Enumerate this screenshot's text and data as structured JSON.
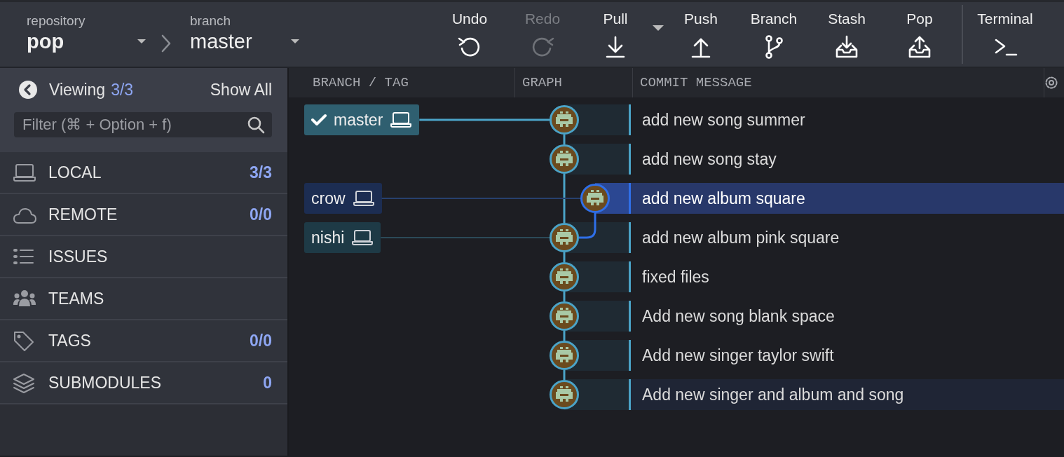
{
  "repository": {
    "label": "repository",
    "name": "pop"
  },
  "branch": {
    "label": "branch",
    "name": "master"
  },
  "toolbar": [
    {
      "kind": "undo",
      "label": "Undo",
      "disabled": false
    },
    {
      "kind": "redo",
      "label": "Redo",
      "disabled": true
    },
    {
      "kind": "pull",
      "label": "Pull",
      "disabled": false
    },
    {
      "kind": "dropdown"
    },
    {
      "kind": "push",
      "label": "Push",
      "disabled": false
    },
    {
      "kind": "branch",
      "label": "Branch",
      "disabled": false
    },
    {
      "kind": "stash",
      "label": "Stash",
      "disabled": false
    },
    {
      "kind": "pop",
      "label": "Pop",
      "disabled": false
    },
    {
      "kind": "divider"
    },
    {
      "kind": "terminal",
      "label": "Terminal",
      "disabled": false
    }
  ],
  "sidebar": {
    "viewing_label": "Viewing",
    "viewing_count": "3/3",
    "show_all": "Show All",
    "filter_placeholder": "Filter (⌘ + Option + f)",
    "items": [
      {
        "kind": "local",
        "label": "LOCAL",
        "count": "3/3"
      },
      {
        "kind": "remote",
        "label": "REMOTE",
        "count": "0/0"
      },
      {
        "kind": "issues",
        "label": "ISSUES"
      },
      {
        "kind": "teams",
        "label": "TEAMS"
      },
      {
        "kind": "tags",
        "label": "TAGS",
        "count": "0/0"
      },
      {
        "kind": "submodules",
        "label": "SUBMODULES",
        "count": "0"
      }
    ]
  },
  "graph": {
    "columns": [
      "BRANCH / TAG",
      "GRAPH",
      "COMMIT MESSAGE"
    ],
    "commits": [
      {
        "message": "add new song summer",
        "side_lane": false,
        "selected": false,
        "highlighted": false,
        "ref": {
          "name": "master",
          "current": true
        }
      },
      {
        "message": "add new song stay",
        "side_lane": false,
        "selected": false,
        "highlighted": false
      },
      {
        "message": "add new album square",
        "side_lane": true,
        "selected": true,
        "highlighted": false,
        "ref": {
          "name": "crow",
          "current": false
        }
      },
      {
        "message": "add new album pink square",
        "side_lane": false,
        "selected": false,
        "highlighted": false,
        "ref": {
          "name": "nishi",
          "current": false
        }
      },
      {
        "message": "fixed files",
        "side_lane": false,
        "selected": false,
        "highlighted": false
      },
      {
        "message": "Add new song blank space",
        "side_lane": false,
        "selected": false,
        "highlighted": false
      },
      {
        "message": "Add new singer taylor swift",
        "side_lane": false,
        "selected": false,
        "highlighted": false
      },
      {
        "message": "Add new singer and album and song",
        "side_lane": false,
        "selected": false,
        "highlighted": true
      }
    ]
  }
}
